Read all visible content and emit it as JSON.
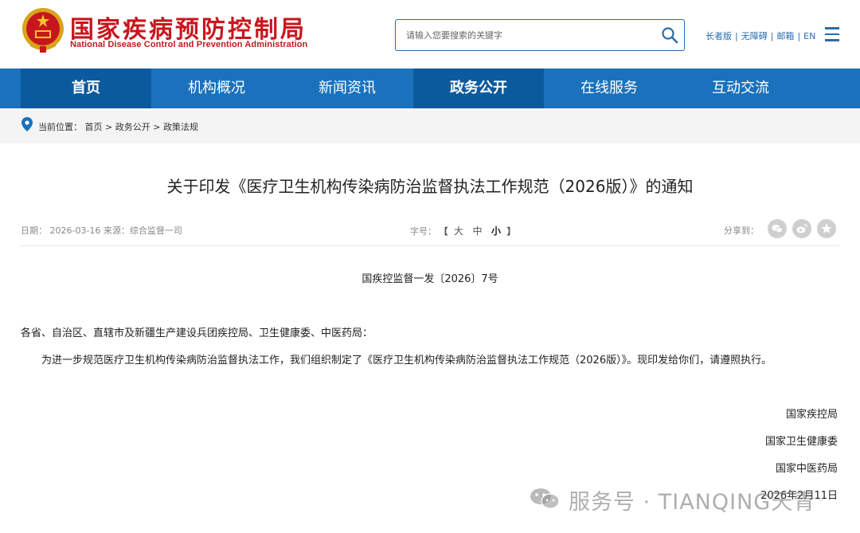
{
  "header": {
    "site_title": "国家疾病预防控制局",
    "site_subtitle": "National Disease Control and Prevention Administration",
    "search_placeholder": "请输入您要搜索的关键字",
    "top_links": [
      "长者版",
      "无障碍",
      "邮箱",
      "EN"
    ],
    "brand_color": "#c8161d"
  },
  "nav": {
    "items": [
      "首页",
      "机构概况",
      "新闻资讯",
      "政务公开",
      "在线服务",
      "互动交流"
    ],
    "active": [
      "首页",
      "政务公开"
    ],
    "color": "#1a72bd"
  },
  "breadcrumb": {
    "label": "当前位置：",
    "items": [
      "首页",
      "政务公开",
      "政策法规"
    ],
    "separator": ">"
  },
  "article": {
    "title": "关于印发《医疗卫生机构传染病防治监督执法工作规范（2026版）》的通知",
    "meta": "日期：  2026-03-16 来源：综合监督一司",
    "font_label": "字号：",
    "font_sizes": [
      "大",
      "中",
      "小"
    ],
    "font_current": "小",
    "share_label": "分享到：",
    "share_icons": [
      "wechat-icon",
      "weibo-icon",
      "star-icon"
    ],
    "doc_number": "国疾控监督一发〔2026〕7号",
    "recipients": "各省、自治区、直辖市及新疆生产建设兵团疾控局、卫生健康委、中医药局：",
    "body": "为进一步规范医疗卫生机构传染病防治监督执法工作，我们组织制定了《医疗卫生机构传染病防治监督执法工作规范（2026版）》。现印发给你们，请遵照执行。",
    "signatories": [
      "国家疾控局",
      "国家卫生健康委",
      "国家中医药局"
    ],
    "sign_date": "2026年2月11日"
  },
  "watermark": {
    "text": "服务号 · TIANQING天青"
  }
}
